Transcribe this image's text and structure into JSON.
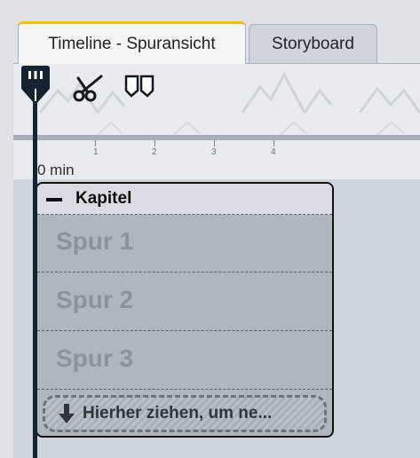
{
  "tabs": [
    {
      "label": "Timeline - Spuransicht",
      "active": true
    },
    {
      "label": "Storyboard",
      "active": false
    }
  ],
  "toolbar": {
    "icons": [
      "playhead-icon",
      "scissors-icon",
      "marker-icon"
    ]
  },
  "ruler": {
    "ticks": [
      "1",
      "2",
      "3",
      "4"
    ],
    "zero_label": "0 min"
  },
  "chapter": {
    "title": "Kapitel",
    "tracks": [
      "Spur 1",
      "Spur 2",
      "Spur 3"
    ],
    "drop_hint": "Hierher ziehen, um ne..."
  },
  "colors": {
    "accent": "#f2c200",
    "playhead": "#14232f",
    "chapter_border": "#111111"
  }
}
